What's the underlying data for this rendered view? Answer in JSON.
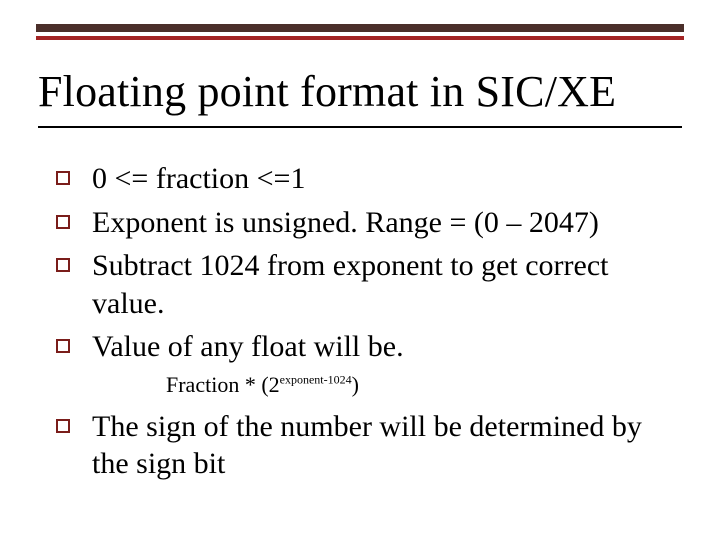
{
  "slide": {
    "title": "Floating point format in SIC/XE",
    "bullets": [
      "0 <= fraction <=1",
      "Exponent is unsigned. Range = (0 – 2047)",
      "Subtract 1024 from exponent to get correct value.",
      "Value of any float will be."
    ],
    "formula": {
      "prefix": "Fraction * (2",
      "superscript": "exponent-1024",
      "suffix": ")"
    },
    "bullets2": [
      "The sign of the number will be determined by the sign bit"
    ]
  },
  "colors": {
    "dark_bar": "#4b2f2a",
    "red_bar": "#a32424",
    "bullet_border": "#7a1d1a"
  }
}
